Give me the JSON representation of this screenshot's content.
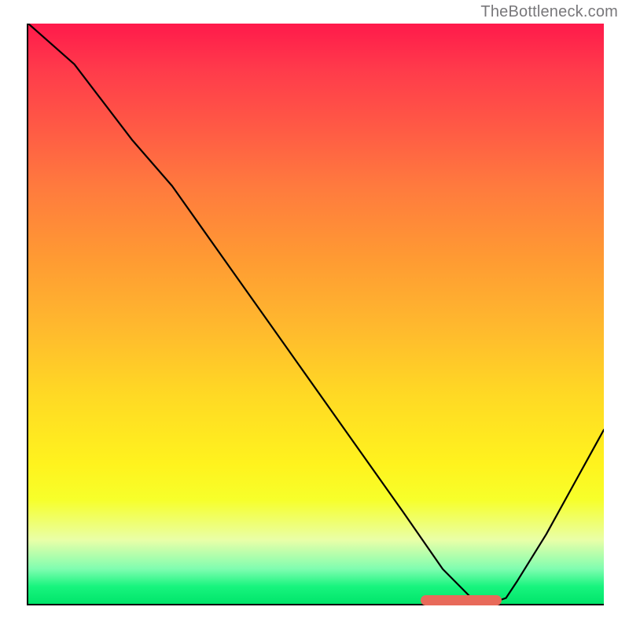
{
  "watermark": "TheBottleneck.com",
  "chart_data": {
    "type": "line",
    "title": "",
    "xlabel": "",
    "ylabel": "",
    "xlim": [
      0,
      100
    ],
    "ylim": [
      0,
      100
    ],
    "series": [
      {
        "name": "bottleneck-curve",
        "x": [
          0,
          8,
          18,
          25,
          35,
          45,
          55,
          65,
          72,
          77,
          80,
          83,
          85,
          90,
          95,
          100
        ],
        "y": [
          100,
          93,
          80,
          72,
          58,
          44,
          30,
          16,
          6,
          1,
          0,
          1,
          4,
          12,
          21,
          30
        ]
      }
    ],
    "annotations": [
      {
        "name": "optimal-range-marker",
        "x_start": 68,
        "x_end": 82,
        "y": 1
      }
    ],
    "background_gradient": {
      "top": "#ff1a4b",
      "middle": "#ffd924",
      "bottom": "#00e56a"
    }
  }
}
